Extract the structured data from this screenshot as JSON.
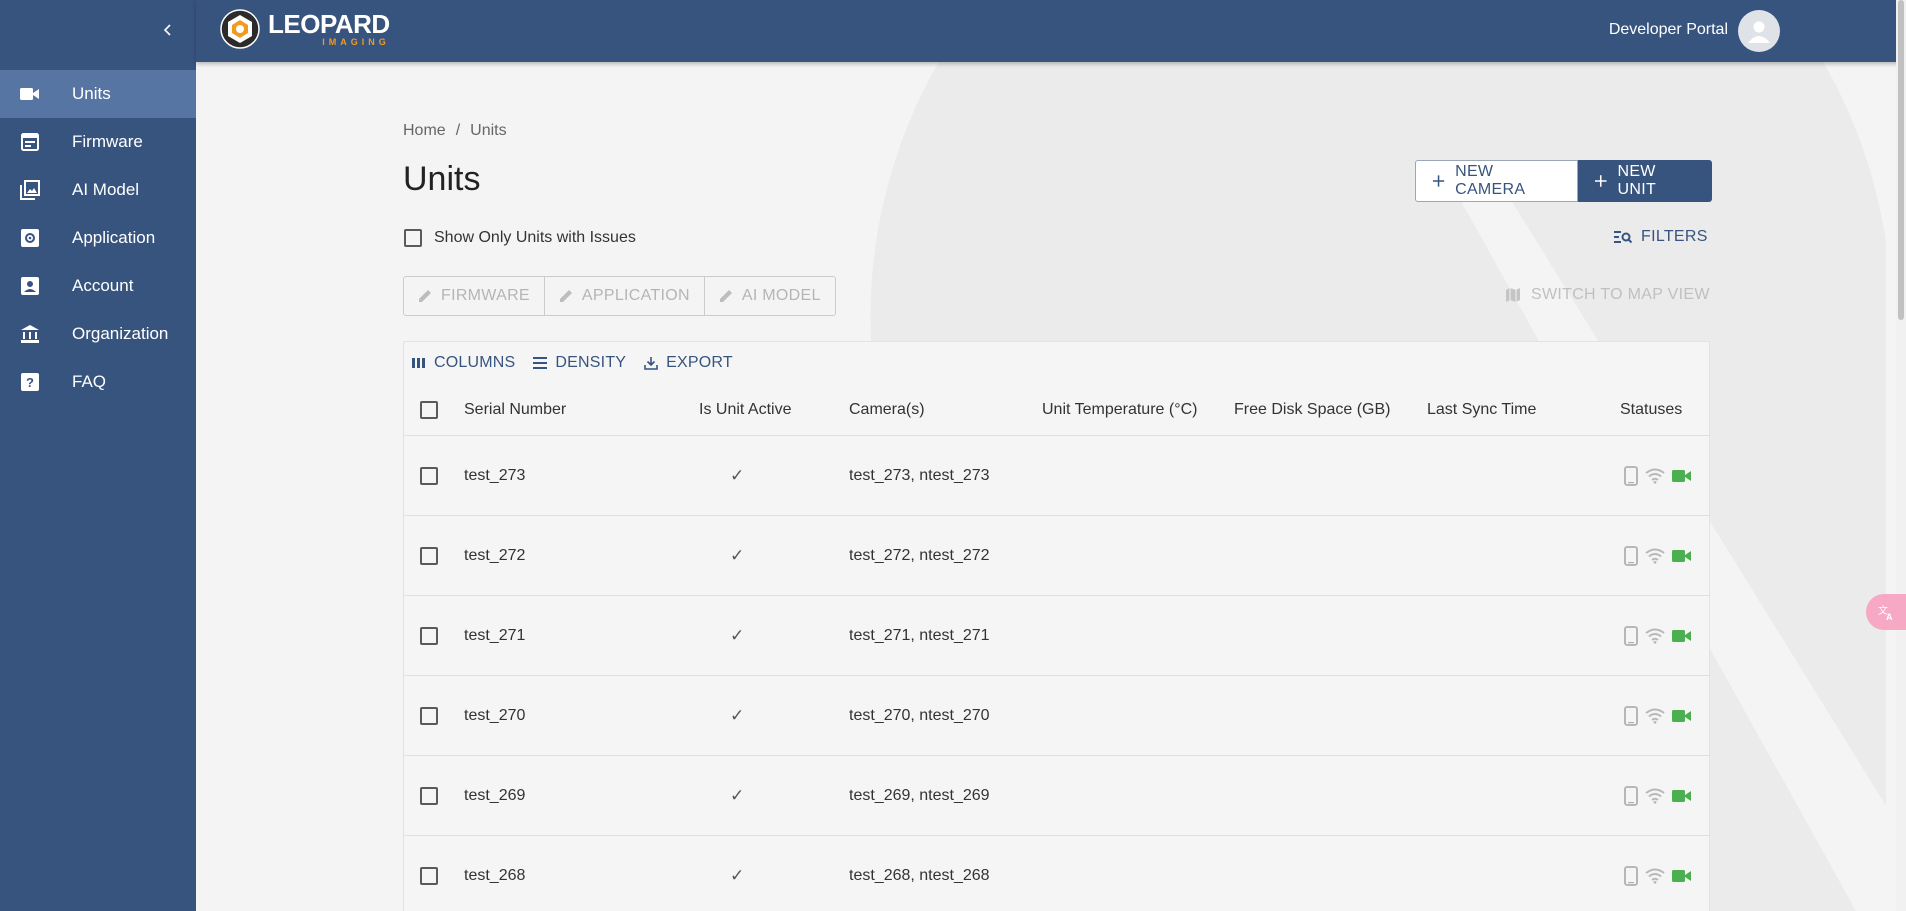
{
  "app": {
    "brand_main": "LEOPARD",
    "brand_sub": "IMAGING",
    "portal_label": "Developer Portal"
  },
  "sidebar": {
    "items": [
      {
        "label": "Units",
        "icon": "videocam-icon",
        "active": true
      },
      {
        "label": "Firmware",
        "icon": "firmware-icon"
      },
      {
        "label": "AI Model",
        "icon": "photo-library-icon"
      },
      {
        "label": "Application",
        "icon": "settings-app-icon"
      },
      {
        "label": "Account",
        "icon": "account-box-icon"
      },
      {
        "label": "Organization",
        "icon": "institution-icon"
      },
      {
        "label": "FAQ",
        "icon": "help-icon"
      }
    ]
  },
  "breadcrumb": {
    "home": "Home",
    "sep": "/",
    "current": "Units"
  },
  "page": {
    "title": "Units",
    "new_camera": "NEW CAMERA",
    "new_unit": "NEW UNIT",
    "issues_label": "Show Only Units with Issues",
    "filters": "FILTERS",
    "edit_firmware": "FIRMWARE",
    "edit_application": "APPLICATION",
    "edit_ai_model": "AI MODEL",
    "switch_map": "SWITCH TO MAP VIEW"
  },
  "grid": {
    "toolbar": {
      "columns": "COLUMNS",
      "density": "DENSITY",
      "export": "EXPORT"
    },
    "headers": {
      "serial": "Serial Number",
      "active": "Is Unit Active",
      "camera": "Camera(s)",
      "temp": "Unit Temperature (°C)",
      "disk": "Free Disk Space (GB)",
      "sync": "Last Sync Time",
      "status": "Statuses"
    },
    "rows": [
      {
        "serial": "test_273",
        "active": "✓",
        "cameras": "test_273, ntest_273"
      },
      {
        "serial": "test_272",
        "active": "✓",
        "cameras": "test_272, ntest_272"
      },
      {
        "serial": "test_271",
        "active": "✓",
        "cameras": "test_271, ntest_271"
      },
      {
        "serial": "test_270",
        "active": "✓",
        "cameras": "test_270, ntest_270"
      },
      {
        "serial": "test_269",
        "active": "✓",
        "cameras": "test_269, ntest_269"
      },
      {
        "serial": "test_268",
        "active": "✓",
        "cameras": "test_268, ntest_268"
      }
    ]
  },
  "colors": {
    "primary": "#37547f",
    "active_nav": "#5675a2",
    "brand_orange": "#f29a1f",
    "status_green": "#4caf50"
  }
}
